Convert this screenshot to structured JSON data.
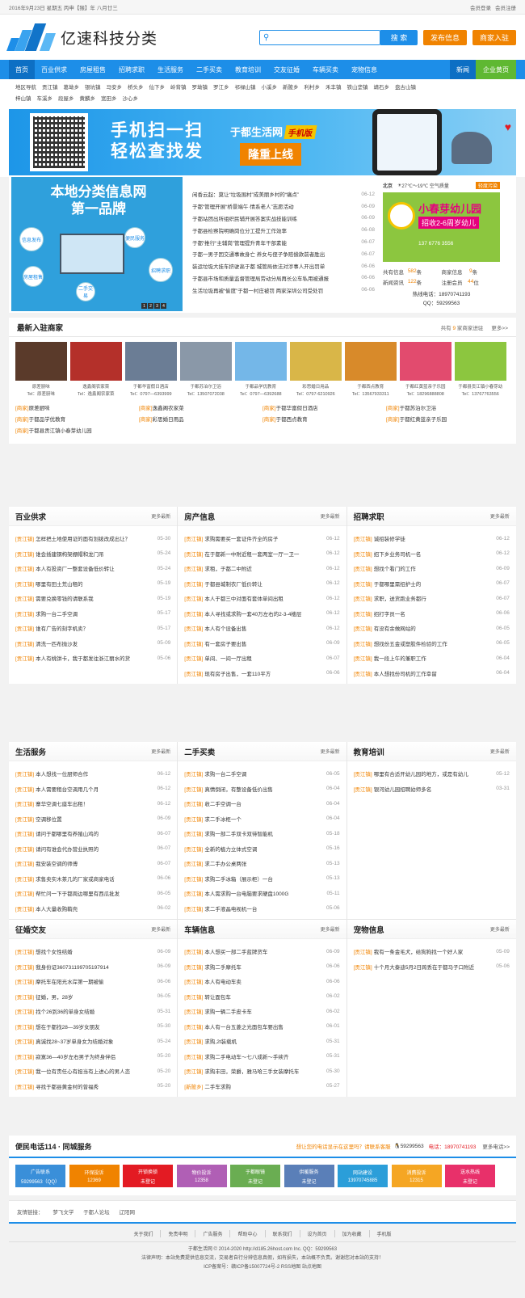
{
  "topbar": {
    "date": "2016年9月23日 星期五 丙申【猴】年 八月廿三",
    "login": "会员登录",
    "register": "会员注册"
  },
  "header": {
    "logo_text": "亿速科技分类",
    "search_btn": "搜 索",
    "post_btn": "发布信息",
    "join_btn": "商家入驻"
  },
  "nav": {
    "items": [
      "首页",
      "百业供求",
      "房屋租售",
      "招聘求职",
      "生活服务",
      "二手买卖",
      "教育培训",
      "交友征婚",
      "车辆买卖",
      "宠物信息"
    ],
    "news": "新闻",
    "enterprise": "企业黄页"
  },
  "areas": [
    "地区导航",
    "贡江镇",
    "葛坳乡",
    "银坑镇",
    "马安乡",
    "桥头乡",
    "仙下乡",
    "岭背镇",
    "罗坳镇",
    "罗江乡",
    "祁禄山镇",
    "小溪乡",
    "新陂乡",
    "利村乡",
    "禾丰镇",
    "铁山垄镇",
    "靖石乡",
    "盘古山镇",
    "梓山镇",
    "车溪乡",
    "段屋乡",
    "黄麟乡",
    "宽田乡",
    "沙心乡"
  ],
  "banner": {
    "line1": "手机扫一扫",
    "line2": "轻松查找发",
    "brand": "于都生活网",
    "tag": "手机版",
    "launch": "隆重上线"
  },
  "slide": {
    "title1": "本地分类信息网",
    "title2": "第一品牌",
    "balls": [
      "信息发布",
      "便民服务",
      "招聘求职",
      "房屋租售",
      "二手交易"
    ],
    "pages": [
      "1",
      "2",
      "3",
      "4"
    ]
  },
  "news": [
    {
      "t": "闲香云起：莫让“垃圾围村”成美丽乡村的“痛点”",
      "d": "06-12"
    },
    {
      "t": "于都“管理开展“桥景端午·情系老人”志愿活动",
      "d": "06-09"
    },
    {
      "t": "于都站团出所组织民辅开展答案实战技能训练",
      "d": "06-09"
    },
    {
      "t": "于都县检察院明确岗位分工提升工作效率",
      "d": "06-08"
    },
    {
      "t": "于都“推行“主辅岗”管理提升青年干部素能",
      "d": "06-07"
    },
    {
      "t": "于都一男子因交通事故身亡 养女与侄子争赔偿款前者胜出",
      "d": "06-07"
    },
    {
      "t": "装运垃圾大挂车挤驶高于都 城管局依法对涉事人开出罚单",
      "d": "06-06"
    },
    {
      "t": "于都县市场和质量监督管理局劳动分局再长公车私用被通报",
      "d": "06-06"
    },
    {
      "t": "生活垃圾再被“偷度”于都一村庄被罚 两家深圳公司受处罚",
      "d": "06-06"
    }
  ],
  "rightbox": {
    "city": "北京",
    "temp": "27℃～19℃",
    "air": "空气质量",
    "mm": "轻度污染",
    "kg_name": "小春芽幼儿园",
    "kg_sub": "招收2-6周岁幼儿",
    "kg_phone": "137 6776 3556",
    "stats": [
      {
        "l": "共有信息",
        "v": "582",
        "u": "条"
      },
      {
        "l": "商家信息",
        "v": "9",
        "u": "条"
      },
      {
        "l": "新闻资讯",
        "v": "122",
        "u": "条"
      },
      {
        "l": "注册会员",
        "v": "44",
        "u": "位"
      }
    ],
    "hotline": "热线电话：18970741193",
    "qq": "QQ：59299563"
  },
  "merchants": {
    "title": "最新入驻商家",
    "count_pre": "共有",
    "count": "9",
    "count_suf": "家商家进驻",
    "more": "更多>>",
    "thumbs": [
      {
        "n": "原差厨味",
        "p": "Tel：原差厨味",
        "c": "#5a3a2a"
      },
      {
        "n": "逸鑫阁农家菜",
        "p": "Tel：逸鑫阁农家菜",
        "c": "#b4302a"
      },
      {
        "n": "于都华富假日酒店",
        "p": "Tel：0797—6393999",
        "c": "#6b7d95"
      },
      {
        "n": "于都苏泊尔卫浴",
        "p": "Tel：13507072038",
        "c": "#8a98a8"
      },
      {
        "n": "于都品学优教育",
        "p": "Tel：0797—6392688",
        "c": "#74b7e8"
      },
      {
        "n": "彩思婚日用品",
        "p": "Tel：0797-6210926",
        "c": "#d9b648"
      },
      {
        "n": "于都西点教育",
        "p": "Tel：13567933311",
        "c": "#d88a2a"
      },
      {
        "n": "于都红黄蓝亲子乐园",
        "p": "Tel：18296888808",
        "c": "#e24b6e"
      },
      {
        "n": "于都县贡江镇小春芽幼",
        "p": "Tel：13767763556",
        "c": "#8cc63f"
      }
    ],
    "list": [
      "原差厨味",
      "逸鑫阁农家菜",
      "于都华富假日酒店",
      "于都苏泊尔卫浴",
      "于都品学优教育",
      "彩思婚日用品",
      "于都西点教育",
      "于都红黄蓝亲子乐园",
      "于都县贡江镇小春芽幼儿园"
    ],
    "tag": "[商家]"
  },
  "cats": [
    {
      "title": "百业供求",
      "more": "更多最新",
      "rows": [
        [
          "[贡江镇]",
          "怎样把土地使用证的面有划拨改成出让？",
          "05-30"
        ],
        [
          "[贡江镇]",
          "谁会插建钢构架棚帽和龙门吊",
          "05-24"
        ],
        [
          "[贡江镇]",
          "本人有投资厂一整套设备低价转让",
          "05-24"
        ],
        [
          "[贡江镇]",
          "哪里有田土荒山租的",
          "05-19"
        ],
        [
          "[贡江镇]",
          "需要兑换零钱的请联系我",
          "05-19"
        ],
        [
          "[贡江镇]",
          "求购一台二手空调",
          "05-17"
        ],
        [
          "[贡江镇]",
          "谁有广告的刻字机卖？",
          "05-17"
        ],
        [
          "[贡江镇]",
          "清洗一匹布抛沙发",
          "05-09"
        ],
        [
          "[贡江镇]",
          "本人有桃饼卡，我于都发往浙江丽水的货",
          "05-06"
        ]
      ]
    },
    {
      "title": "房产信息",
      "more": "更多最新",
      "rows": [
        [
          "[贡江镇]",
          "求购需要买一套证件齐全的房子",
          "06-12"
        ],
        [
          "[贡江镇]",
          "在于都新一中附近租一套两室一厅一卫一",
          "06-12"
        ],
        [
          "[贡江镇]",
          "求租，于都二中附近",
          "06-12"
        ],
        [
          "[贡江镇]",
          "于都县城制衣厂低价转让",
          "06-12"
        ],
        [
          "[贡江镇]",
          "本人于都三中对面有套体单间出租",
          "06-12"
        ],
        [
          "[贡江镇]",
          "本人寻找或求购一套40万左右的2-3-4楼层",
          "06-12"
        ],
        [
          "[贡江镇]",
          "本人有个设备出售",
          "06-12"
        ],
        [
          "[贡江镇]",
          "有一套房子要出售",
          "06-09"
        ],
        [
          "[贡江镇]",
          "单间、一间一厅出租",
          "06-07"
        ],
        [
          "[贡江镇]",
          "现有房子出售，一套110平方",
          "06-06"
        ]
      ]
    },
    {
      "title": "招聘求职",
      "more": "更多最新",
      "rows": [
        [
          "[贡江镇]",
          "诚招装修学徒",
          "06-12"
        ],
        [
          "[贡江镇]",
          "招下乡业务司机一名",
          "06-12"
        ],
        [
          "[贡江镇]",
          "想找个看门的工作",
          "06-09"
        ],
        [
          "[贡江镇]",
          "于都哪里需招护士的",
          "06-07"
        ],
        [
          "[贡江镇]",
          "求职，送货跑业务都行",
          "06-07"
        ],
        [
          "[贡江镇]",
          "招打字员一名",
          "06-06"
        ],
        [
          "[贡江镇]",
          "有没有余做网站的",
          "06-05"
        ],
        [
          "[贡江镇]",
          "想找份五金或塑胶件检验的工作",
          "06-05"
        ],
        [
          "[贡江镇]",
          "我一段上午的兼职工作",
          "06-04"
        ],
        [
          "[贡江镇]",
          "本人想找份司机的工作幸留",
          "06-04"
        ]
      ]
    },
    {
      "title": "生活服务",
      "more": "更多最新",
      "rows": [
        [
          "[贡江镇]",
          "本人想找一位厨师合作",
          "06-12"
        ],
        [
          "[贡江镇]",
          "本人需要租台空调用几个月",
          "06-12"
        ],
        [
          "[贡江镇]",
          "寨华空调七座车出租！",
          "06-12"
        ],
        [
          "[贡江镇]",
          "空调移位置",
          "06-09"
        ],
        [
          "[贡江镇]",
          "请问于都哪里有养殖山鸡的",
          "06-07"
        ],
        [
          "[贡江镇]",
          "请问有谁会代办营业执照的",
          "06-07"
        ],
        [
          "[贡江镇]",
          "我安装空调的师傅",
          "06-07"
        ],
        [
          "[贡江镇]",
          "求售卖实木茶几的厂家或商家电话",
          "06-06"
        ],
        [
          "[贡江镇]",
          "帮忙问一下于都周边哪里有西瓜批发",
          "06-05"
        ],
        [
          "[贡江镇]",
          "本人大量收购鞘壳",
          "06-02"
        ]
      ]
    },
    {
      "title": "二手买卖",
      "more": "更多最新",
      "rows": [
        [
          "[贡江镇]",
          "求购一台二手空调",
          "06-05"
        ],
        [
          "[贡江镇]",
          "真情倒闭，有整设备低价出售",
          "06-04"
        ],
        [
          "[贡江镇]",
          "收二手空调一台",
          "06-04"
        ],
        [
          "[贡江镇]",
          "求二手冰柜一个",
          "06-04"
        ],
        [
          "[贡江镇]",
          "求购一部二手双卡双待智能机",
          "05-18"
        ],
        [
          "[贡江镇]",
          "全新的植力立体式空调",
          "05-16"
        ],
        [
          "[贡江镇]",
          "求二手办公桌两张",
          "05-13"
        ],
        [
          "[贡江镇]",
          "求购二手冰箱（展示柜）一台",
          "05-13"
        ],
        [
          "[贡江镇]",
          "本人需求购一台电脑要求硬盘1000G",
          "05-11"
        ],
        [
          "[贡江镇]",
          "求二手液晶电视机一台",
          "05-06"
        ]
      ]
    },
    {
      "title": "教育培训",
      "more": "更多最新",
      "rows": [
        [
          "[贡江镇]",
          "哪里有合适开幼儿园的地方，或是有幼儿",
          "05-12"
        ],
        [
          "[贡江镇]",
          "银河幼儿园招聘幼师多名",
          "03-31"
        ]
      ]
    },
    {
      "title": "征婚交友",
      "more": "更多最新",
      "rows": [
        [
          "[贡江镇]",
          "想找个女性结婚",
          "06-09"
        ],
        [
          "[贡江镇]",
          "我身份证360731199705197914",
          "06-09"
        ],
        [
          "[贡江镇]",
          "摩托车在阳光水岸第一期被偷",
          "06-06"
        ],
        [
          "[贡江镇]",
          "征婚，男，28岁",
          "06-05"
        ],
        [
          "[贡江镇]",
          "找个26到36的单身女结婚",
          "05-31"
        ],
        [
          "[贡江镇]",
          "想在于都找28—39岁女朋友",
          "05-30"
        ],
        [
          "[贡江镇]",
          "真诚找28~37岁单身女为结婚对象",
          "05-24"
        ],
        [
          "[贡江镇]",
          "寂寞36—40岁左右男子为终身伴侣",
          "05-20"
        ],
        [
          "[贡江镇]",
          "我一位有责任心有担当有上进心的男人恋",
          "05-20"
        ],
        [
          "[贡江镇]",
          "寻找于都县黄金村的曾福秀",
          "05-20"
        ]
      ]
    },
    {
      "title": "车辆信息",
      "more": "更多最新",
      "rows": [
        [
          "[贡江镇]",
          "本人想买一部二手蓝牌货车",
          "06-09"
        ],
        [
          "[贡江镇]",
          "求购二手摩托车",
          "06-06"
        ],
        [
          "[贡江镇]",
          "本人有电动车卖",
          "06-06"
        ],
        [
          "[贡江镇]",
          "转让面包车",
          "06-02"
        ],
        [
          "[贡江镇]",
          "求购一辆二手皮卡车",
          "06-02"
        ],
        [
          "[贡江镇]",
          "本人有一台五菱之光面包车要出售",
          "06-01"
        ],
        [
          "[贡江镇]",
          "求购,2t装载机",
          "05-31"
        ],
        [
          "[贡江镇]",
          "求购二手电动车～七八成新～手续齐",
          "05-31"
        ],
        [
          "[贡江镇]",
          "求购丰田，荣爵，雅马哈三手女装摩托车",
          "05-30"
        ],
        [
          "[新陂乡]",
          "二手车求购",
          "05-27"
        ]
      ]
    },
    {
      "title": "宠物信息",
      "more": "更多最新",
      "rows": [
        [
          "[贡江镇]",
          "我有一条金毛犬，给狗狗找一个好人家",
          "05-09"
        ],
        [
          "[贡江镇]",
          "十个月大泰迪5月2日跨丢在于都马子口附近",
          "05-06"
        ]
      ]
    }
  ],
  "bianmin": {
    "title": "便民电话114 · 同城服务",
    "ask": "想让您的电话显示在这里吗？请联系客服",
    "qq": "59299563",
    "tel": "电话：18970741193",
    "more": "更多电话>>",
    "tiles": [
      {
        "n": "广告联系",
        "v": "59299563（QQ）",
        "c": "#3a8fd9"
      },
      {
        "n": "环保投诉",
        "v": "12369",
        "c": "#f08300"
      },
      {
        "n": "开锁换锁",
        "v": "未登记",
        "c": "#e31b23"
      },
      {
        "n": "物价投诉",
        "v": "12358",
        "c": "#b05fb5"
      },
      {
        "n": "于都眼镜",
        "v": "未登记",
        "c": "#6aad52"
      },
      {
        "n": "供暖服务",
        "v": "未登记",
        "c": "#5a7fb8"
      },
      {
        "n": "网站建设",
        "v": "13970745885",
        "c": "#2b9ed9"
      },
      {
        "n": "消费投诉",
        "v": "12315",
        "c": "#f5a623"
      },
      {
        "n": "送水热线",
        "v": "未登记",
        "c": "#e8306a"
      }
    ]
  },
  "friends": {
    "label": "友情链接：",
    "items": [
      "梦飞文学",
      "于都人论坛",
      "辽阳网"
    ]
  },
  "footer": {
    "nav": [
      "关于我们",
      "免责申明",
      "广告服务",
      "帮助中心",
      "联系我们",
      "设为首页",
      "加为收藏",
      "手机版"
    ],
    "line1": "于都生活网 © 2014-2020 http://d185.26host.com Inc. QQ：59299563",
    "line2": "法律声明：本站免费提供信息交流，交易者自行分辨信息真假，如有损失，本站概不负责。谢谢您对本站的支持！",
    "line3": "ICP备案号：赣ICP备15007724号-2 RSS地图 站点地图"
  }
}
